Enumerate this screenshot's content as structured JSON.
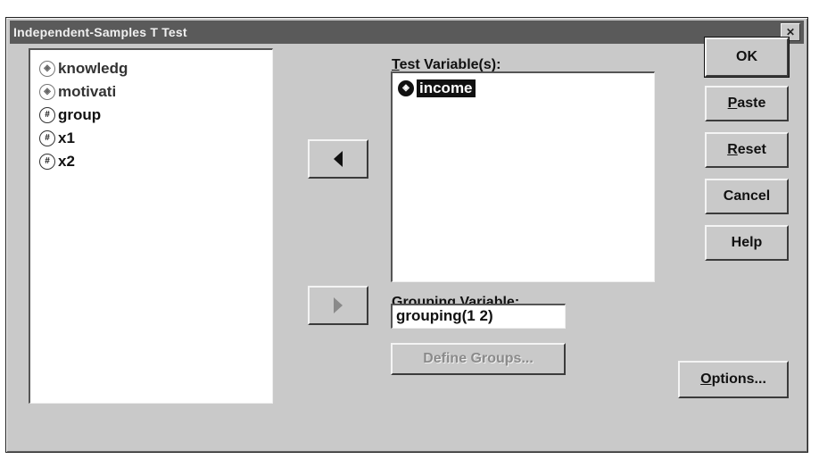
{
  "dialog": {
    "title": "Independent-Samples T Test",
    "title_icon": "dialog-icon"
  },
  "source_variables": [
    {
      "label": "knowledg",
      "icon": "scale-variable-icon",
      "dim": true
    },
    {
      "label": "motivati",
      "icon": "scale-variable-icon",
      "dim": true
    },
    {
      "label": "group",
      "icon": "numeric-variable-icon",
      "dim": false
    },
    {
      "label": "x1",
      "icon": "numeric-variable-icon",
      "dim": false
    },
    {
      "label": "x2",
      "icon": "numeric-variable-icon",
      "dim": false
    }
  ],
  "test_variables": {
    "label_underlined": "T",
    "label_rest": "est Variable(s):",
    "items": [
      {
        "label": "income",
        "icon": "scale-variable-icon",
        "selected": true
      }
    ]
  },
  "grouping": {
    "label_underlined": "G",
    "label_rest": "rouping Variable:",
    "value": "grouping(1 2)"
  },
  "buttons": {
    "ok": "OK",
    "paste_u": "P",
    "paste_rest": "aste",
    "reset_u": "R",
    "reset_rest": "eset",
    "cancel": "Cancel",
    "help": "Help",
    "define_groups": "Define Groups...",
    "options_u": "O",
    "options_rest": "ptions..."
  }
}
